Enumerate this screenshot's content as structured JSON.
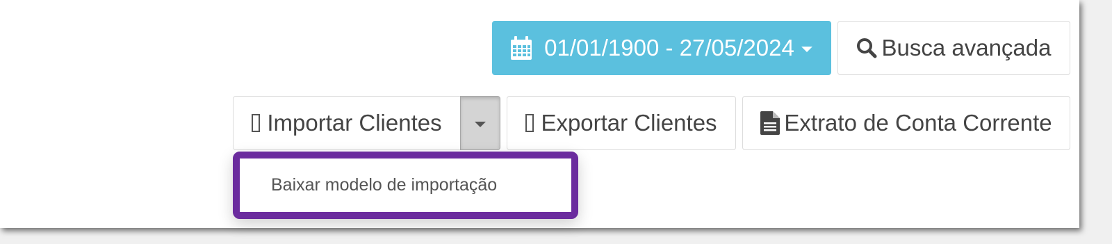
{
  "toolbar": {
    "date_range_label": "01/01/1900 - 27/05/2024",
    "search_label": "Busca avançada",
    "import_label": "Importar Clientes",
    "export_label": "Exportar Clientes",
    "statement_label": "Extrato de Conta Corrente"
  },
  "import_menu": {
    "items": [
      {
        "label": "Baixar modelo de importação"
      }
    ]
  },
  "colors": {
    "date_button_bg": "#5bc0de",
    "highlight_border": "#6b2c9e"
  },
  "icons": {
    "date": "calendar-icon",
    "search": "search-icon",
    "import": "missing-glyph-icon",
    "export": "missing-glyph-icon",
    "statement": "file-text-icon",
    "dropdown": "caret-down-icon"
  }
}
